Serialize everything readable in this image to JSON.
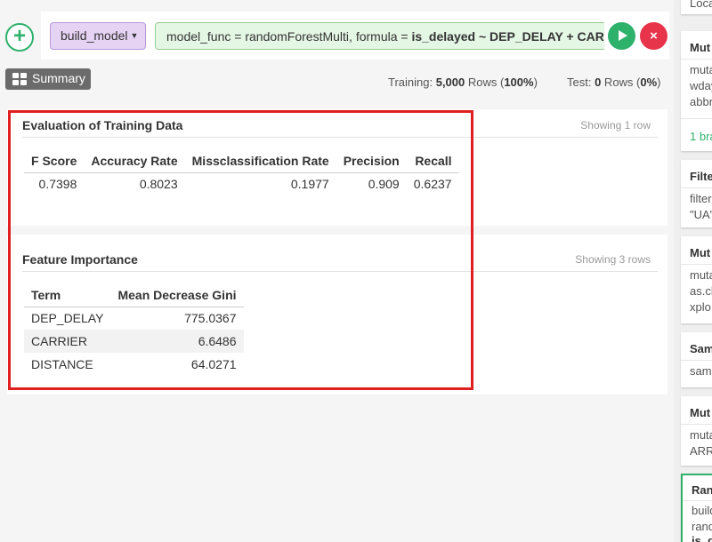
{
  "toolbar": {
    "add_label": "+",
    "command_name": "build_model",
    "command_text": "model_func = randomForestMulti, formula = ",
    "formula_target": "is_delayed",
    "formula_tilde": " ~ ",
    "formula_terms": "DEP_DELAY + CARRIE",
    "cancel_label": "×"
  },
  "summary_button": {
    "label": "Summary"
  },
  "stats": {
    "training_label": "Training: ",
    "training_rows": "5,000",
    "training_rows_unit": " Rows (",
    "training_pct": "100%",
    "training_close": ")",
    "test_label": "Test: ",
    "test_rows": "0",
    "test_rows_unit": " Rows (",
    "test_pct": "0%",
    "test_close": ")"
  },
  "evaluation": {
    "title": "Evaluation of Training Data",
    "count": "Showing 1 row",
    "columns": [
      "F Score",
      "Accuracy Rate",
      "Missclassification Rate",
      "Precision",
      "Recall"
    ],
    "row": [
      "0.7398",
      "0.8023",
      "0.1977",
      "0.909",
      "0.6237"
    ]
  },
  "importance": {
    "title": "Feature Importance",
    "count": "Showing 3 rows",
    "columns": [
      "Term",
      "Mean Decrease Gini"
    ],
    "rows": [
      [
        "DEP_DELAY",
        "775.0367"
      ],
      [
        "CARRIER",
        "6.6486"
      ],
      [
        "DISTANCE",
        "64.0271"
      ]
    ]
  },
  "sidebar": {
    "cards": [
      {
        "title": "",
        "lines": [
          "Loca"
        ]
      },
      {
        "title": "Mut",
        "lines": [
          "muta",
          "wday",
          "abbr"
        ],
        "link": "1 bra"
      },
      {
        "title": "Filte",
        "lines": [
          "filter",
          "\"UA\""
        ]
      },
      {
        "title": "Mut",
        "lines": [
          "muta",
          "as.ch",
          "xplo"
        ]
      },
      {
        "title": "Sam",
        "lines": [
          "samp"
        ]
      },
      {
        "title": "Mut",
        "lines": [
          "muta",
          "ARR"
        ]
      },
      {
        "title": "Ran",
        "lines": [
          "build",
          "rand",
          "is_d"
        ]
      }
    ]
  }
}
